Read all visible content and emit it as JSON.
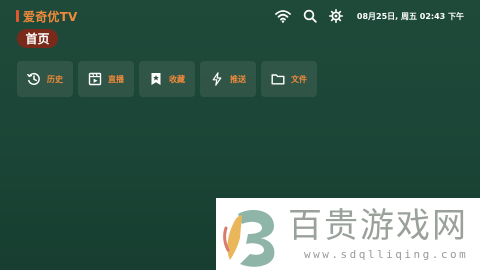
{
  "app": {
    "brand_title": "爱奇优TV",
    "clock_text": "08月25日, 周五 02:43 下午"
  },
  "status_icons": [
    {
      "name": "wifi-icon"
    },
    {
      "name": "search-icon"
    },
    {
      "name": "gear-icon"
    }
  ],
  "nav": {
    "home_label": "首页"
  },
  "tiles": [
    {
      "id": "history",
      "label": "历史",
      "icon": "clock-history-icon"
    },
    {
      "id": "live",
      "label": "直播",
      "icon": "live-tv-icon"
    },
    {
      "id": "favorites",
      "label": "收藏",
      "icon": "bookmark-star-icon"
    },
    {
      "id": "push",
      "label": "推送",
      "icon": "lightning-icon"
    },
    {
      "id": "files",
      "label": "文件",
      "icon": "folder-icon"
    }
  ],
  "watermark": {
    "site_name": "百贵游戏网",
    "url": "www.sdqlliqing.com"
  },
  "colors": {
    "background": "#1b4536",
    "accent_orange": "#f08a3a",
    "home_pill": "#7a2a1a",
    "brand_bar": "#e1582f"
  }
}
